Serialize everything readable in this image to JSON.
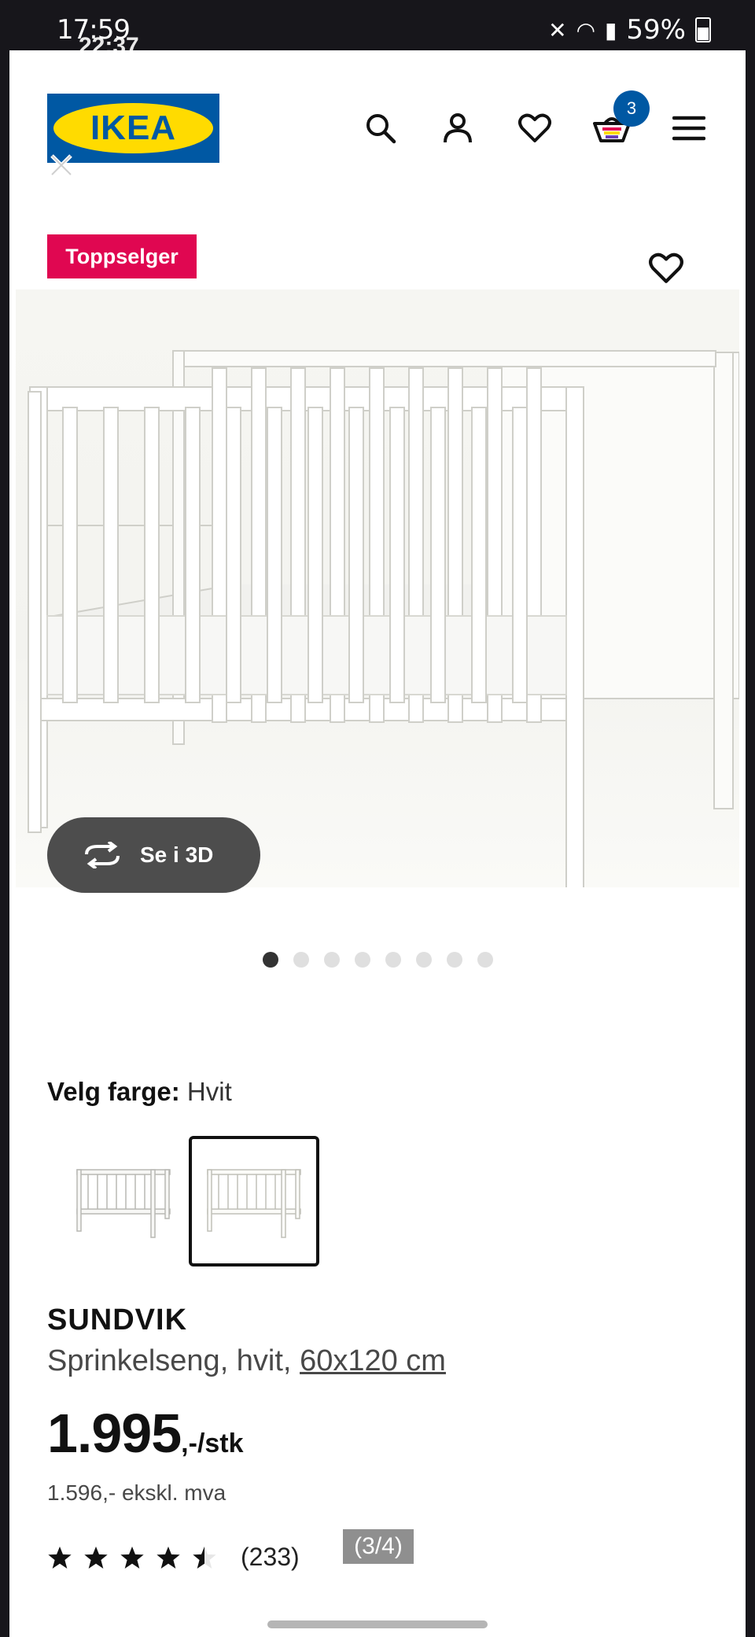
{
  "status_bar": {
    "time": "17:59",
    "overlap_time": "22:37",
    "battery": "59%"
  },
  "header": {
    "logo_text": "IKEA",
    "cart_count": "3",
    "icons": [
      "search-icon",
      "user-icon",
      "heart-icon",
      "cart-icon",
      "menu-icon"
    ]
  },
  "product_image": {
    "tag": "Toppselger",
    "view_3d_label": "Se i 3D",
    "dots_total": 8,
    "dots_active": 1
  },
  "color_picker": {
    "label": "Velg farge:",
    "value": "Hvit",
    "selected_index": 1
  },
  "product": {
    "name": "SUNDVIK",
    "description": "Sprinkelseng, hvit, ",
    "size": "60x120 cm",
    "price": "1.995",
    "price_suffix": ",-/stk",
    "price_ex_vat": "1.596,- ekskl. mva",
    "rating": 4.5,
    "review_count": "(233)"
  },
  "page_indicator": "(3/4)",
  "colors": {
    "ikea_blue": "#0058a3",
    "ikea_yellow": "#ffdb00",
    "tag_red": "#e00751",
    "dark_button": "#4d4d4d"
  }
}
